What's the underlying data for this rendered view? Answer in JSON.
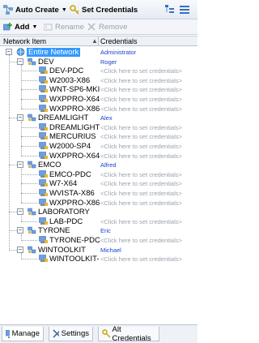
{
  "toolbar": {
    "auto_create_label": "Auto Create",
    "set_credentials_label": "Set Credentials",
    "add_label": "Add",
    "rename_label": "Rename",
    "remove_label": "Remove"
  },
  "columns": {
    "item": "Network Item",
    "credentials": "Credentials"
  },
  "tree": {
    "root": {
      "label": "Entire Network",
      "credential": "Administrator"
    },
    "click_text": "<Click here to set credentials>",
    "groups": [
      {
        "label": "DEV",
        "credential": "Roger",
        "items": [
          "DEV-PDC",
          "W2003-X86",
          "WNT-SP6-MKI",
          "WXPPRO-X64",
          "WXPPRO-X86"
        ]
      },
      {
        "label": "DREAMLIGHT",
        "credential": "Alex",
        "items": [
          "DREAMLIGHT",
          "MERCURIUS",
          "W2000-SP4",
          "WXPPRO-X64"
        ]
      },
      {
        "label": "EMCO",
        "credential": "Alfred",
        "items": [
          "EMCO-PDC",
          "W7-X64",
          "WVISTA-X86",
          "WXPPRO-X86"
        ]
      },
      {
        "label": "LABORATORY",
        "credential": "",
        "items": [
          "LAB-PDC"
        ]
      },
      {
        "label": "TYRONE",
        "credential": "Eric",
        "items": [
          "TYRONE-PDC"
        ]
      },
      {
        "label": "WINTOOLKIT",
        "credential": "Michael",
        "items": [
          "WINTOOLKIT-"
        ]
      }
    ]
  },
  "tabs": {
    "manage": "Manage",
    "settings": "Settings",
    "alt_credentials": "Alt Credentials"
  }
}
